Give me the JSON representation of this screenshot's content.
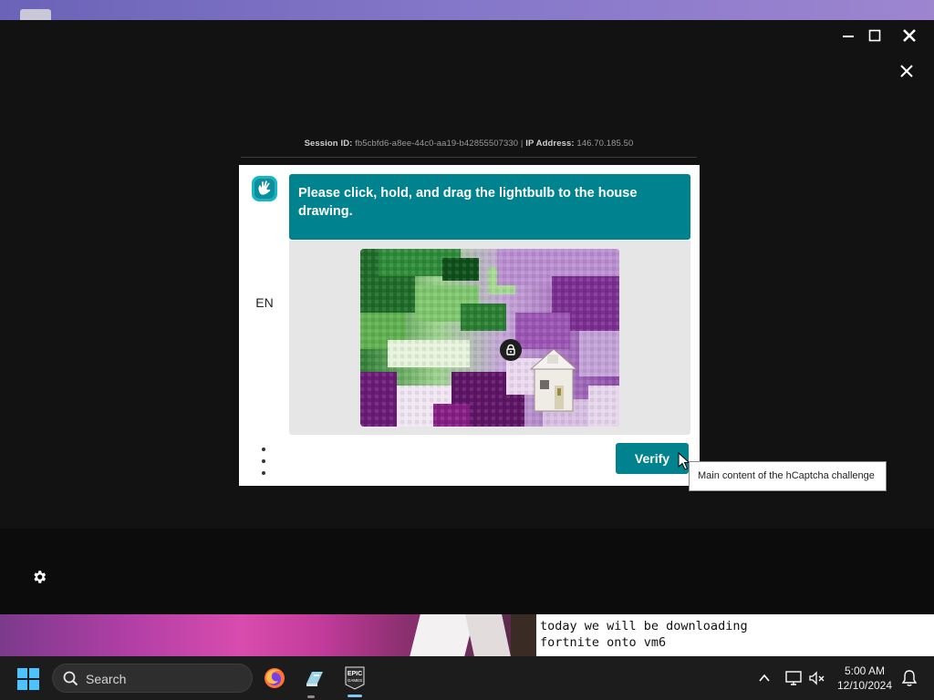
{
  "session": {
    "session_label": "Session ID:",
    "session_id": "fb5cbfd6-a8ee-44c0-aa19-b42855507330",
    "separator": "|",
    "ip_label": "IP Address:",
    "ip_address": "146.70.185.50"
  },
  "captcha": {
    "language": "EN",
    "prompt": "Please click, hold, and drag the lightbulb to the house drawing.",
    "verify_label": "Verify",
    "accent_color": "#00838f"
  },
  "tooltip": {
    "text": "Main content of the hCaptcha challenge"
  },
  "stream": {
    "caption_line1": "today we will be downloading",
    "caption_line2": "fortnite onto vm6"
  },
  "taskbar": {
    "search_label": "Search",
    "time": "5:00 AM",
    "date": "12/10/2024",
    "pinned": [
      "firefox-icon",
      "drive-icon",
      "epic-games-icon"
    ]
  }
}
